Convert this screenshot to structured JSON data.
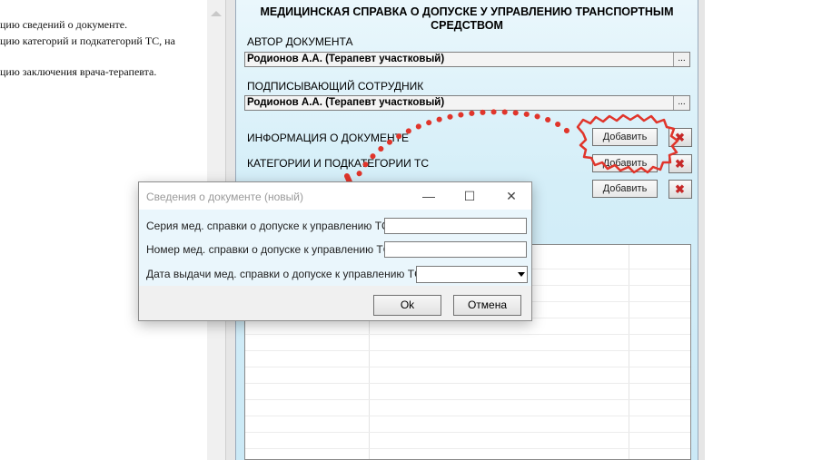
{
  "document": {
    "lines": [
      "цию сведений о документе.",
      "цию категорий и подкатегорий ТС, на",
      "цию заключения врача-терапевта."
    ]
  },
  "form": {
    "title_line1": "МЕДИЦИНСКАЯ СПРАВКА О ДОПУСКЕ У УПРАВЛЕНИЮ ТРАНСПОРТНЫМ",
    "title_line2": "СРЕДСТВОМ",
    "author_label": "АВТОР ДОКУМЕНТА",
    "author_value": "Родионов А.А. (Терапевт участковый)",
    "signer_label": "ПОДПИСЫВАЮЩИЙ СОТРУДНИК",
    "signer_value": "Родионов А.А. (Терапевт участковый)",
    "picker_button": "...",
    "sections": [
      {
        "label": "ИНФОРМАЦИЯ О ДОКУМЕНТЕ",
        "add": "Добавить"
      },
      {
        "label": "КАТЕГОРИИ И ПОДКАТЕГОРИИ ТС",
        "add": "Добавить"
      },
      {
        "label": "",
        "add": "Добавить"
      }
    ]
  },
  "dialog": {
    "title": "Сведения о документе (новый)",
    "minimize": "—",
    "maximize": "☐",
    "close": "✕",
    "series_label": "Серия мед. справки о допуске к управлению ТС:",
    "series_value": "",
    "number_label": "Номер мед. справки о допуске к управлению ТС:",
    "number_value": "",
    "date_label": "Дата выдачи мед. справки о допуске к управлению ТС:",
    "date_value": "",
    "ok": "Ok",
    "cancel": "Отмена"
  },
  "colors": {
    "annotation_red": "#e0352b",
    "panel_blue": "#d4eef8"
  }
}
